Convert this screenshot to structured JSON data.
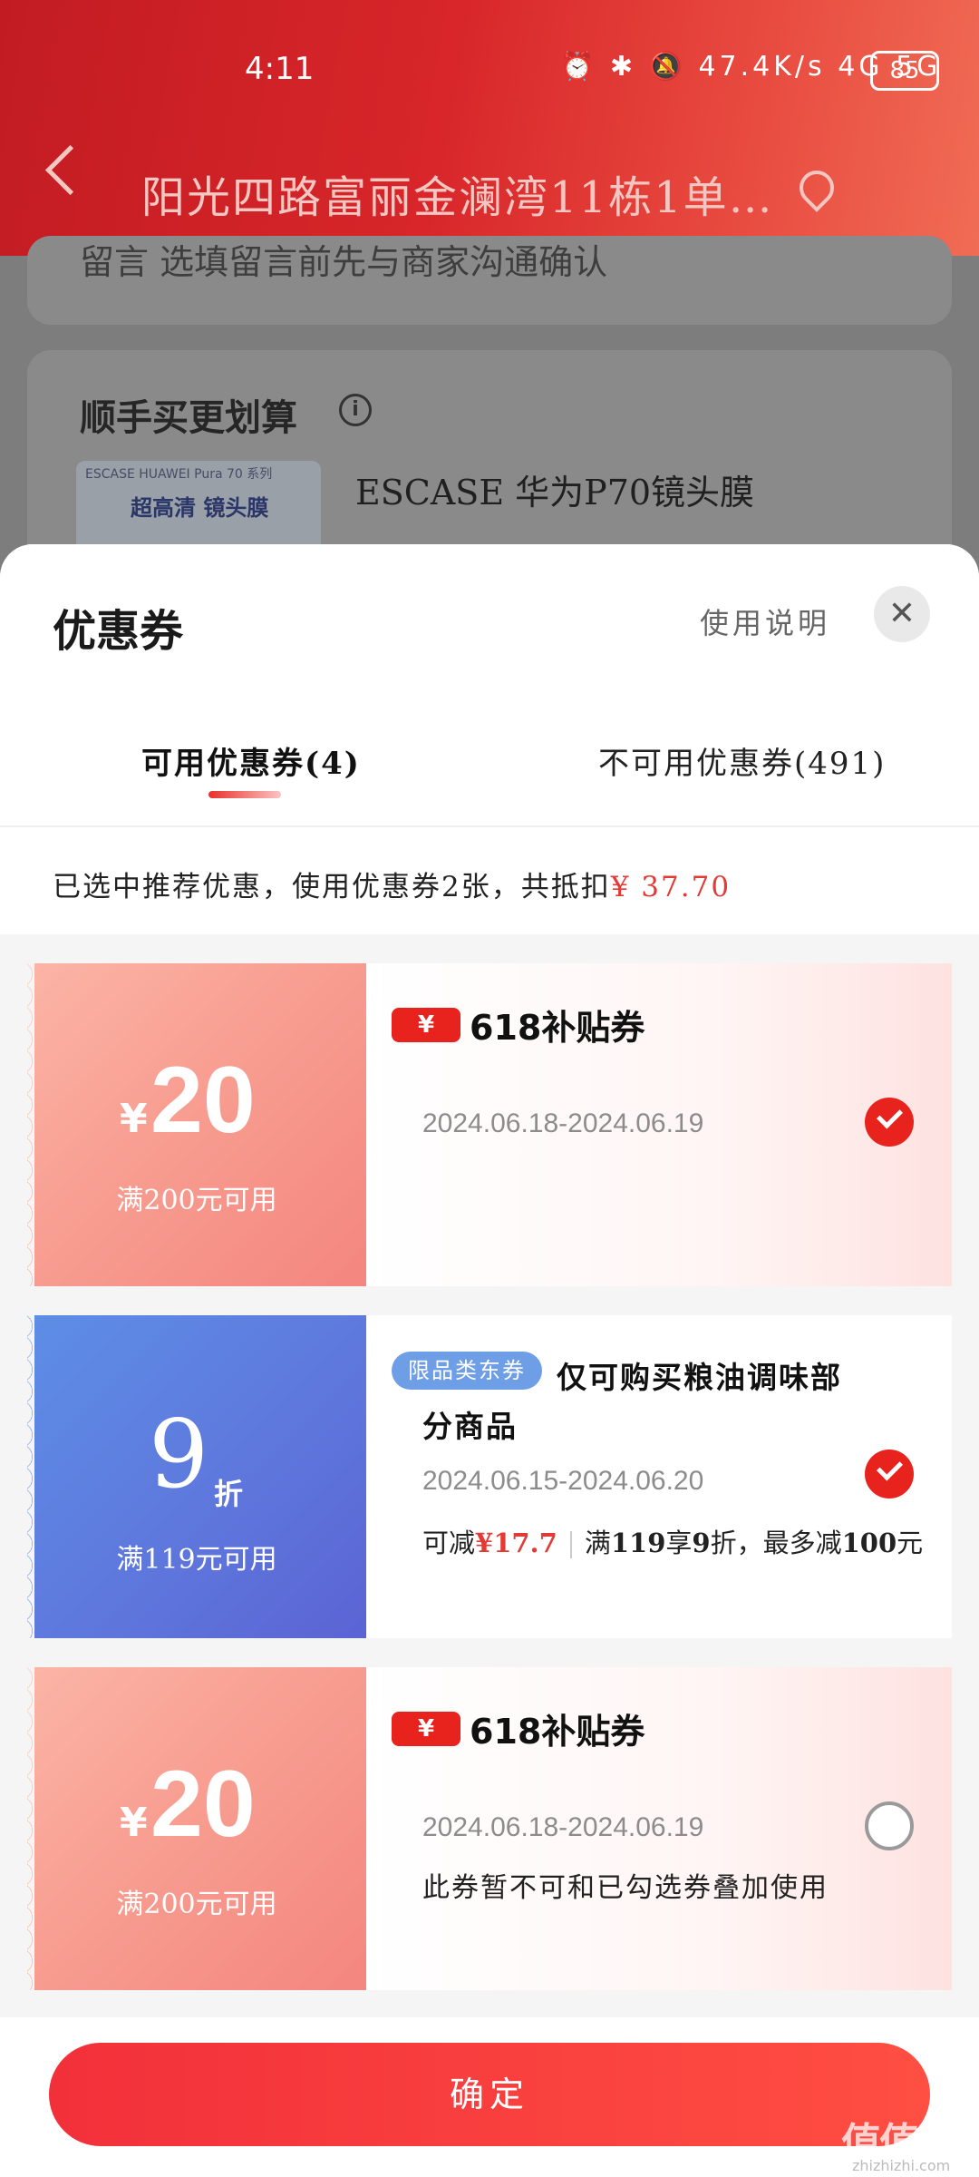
{
  "status_bar": {
    "time": "4:11",
    "icons_text": "⏰ ✱ 🔕 47.4K/s 4G 5G",
    "battery": "85"
  },
  "header": {
    "address": "阳光四路富丽金澜湾11栋1单…"
  },
  "background_page": {
    "card1_text": "留言    选填留言前先与商家沟通确认",
    "section_title": "顺手买更划算",
    "product_image_text1": "ESCASE  HUAWEI Pura 70 系列",
    "product_image_text2": "超高清 镜头膜",
    "product_name": "ESCASE 华为P70镜头膜"
  },
  "sheet": {
    "title": "优惠券",
    "usage_link": "使用说明",
    "close_icon": "close-icon",
    "tabs": [
      {
        "label": "可用优惠券(4)",
        "active": true
      },
      {
        "label": "不可用优惠券(491)",
        "active": false
      }
    ],
    "summary_prefix": "已选中推荐优惠，使用优惠券2张，共抵扣",
    "summary_amount": "¥ 37.70"
  },
  "coupons": [
    {
      "yen": "¥",
      "amount": "20",
      "condition": "满200元可用",
      "badge_yen": "¥",
      "badge_text": "618补贴券",
      "date": "2024.06.18-2024.06.19",
      "selected": true
    },
    {
      "amount": "9",
      "unit": "折",
      "condition": "满119元可用",
      "category_badge": "限品类东券",
      "title_line1": "仅可购买粮油调味部",
      "title_line2": "分商品",
      "date": "2024.06.15-2024.06.20",
      "reduce_label": "可减",
      "reduce_amount": "¥17.7",
      "rule_prefix": "满",
      "rule_num1": "119",
      "rule_mid": "享",
      "rule_num2": "9",
      "rule_mid2": "折，最多减",
      "rule_num3": "100",
      "rule_suffix": "元",
      "selected": true
    },
    {
      "yen": "¥",
      "amount": "20",
      "condition": "满200元可用",
      "badge_yen": "¥",
      "badge_text": "618补贴券",
      "date": "2024.06.18-2024.06.19",
      "note": "此券暂不可和已勾选券叠加使用",
      "selected": false
    }
  ],
  "confirm_label": "确定",
  "watermark": {
    "main": "值值值",
    "sub": "zhizhizhi.com"
  },
  "colors": {
    "accent_red": "#e8221c",
    "header_red": "#c21c22",
    "blue_coupon": "#5d7fe0"
  }
}
